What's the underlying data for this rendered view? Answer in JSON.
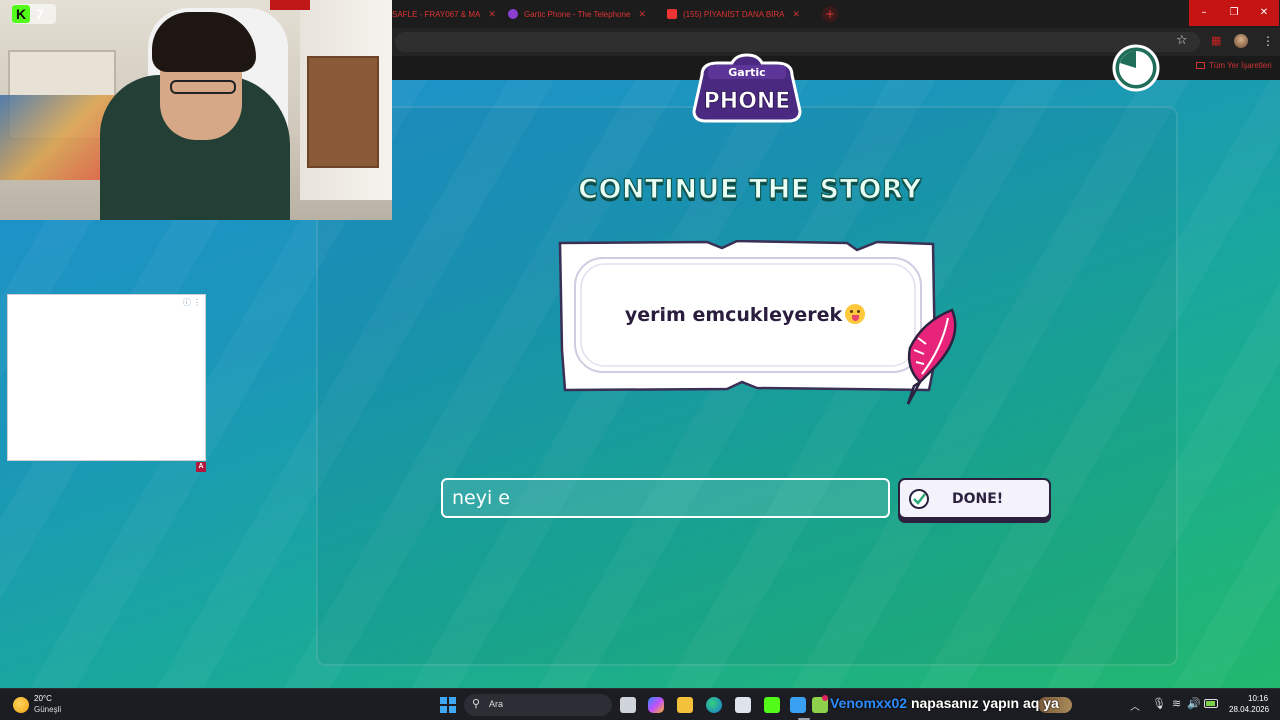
{
  "browser": {
    "tabs": [
      {
        "label": "SAFLE - FRAY067 & MA"
      },
      {
        "label": "Gartic Phone - The Telephone"
      },
      {
        "label": "(155) PİYANİST DANA BİRA"
      }
    ],
    "new_tab_icon": "plus-icon",
    "bookmarks_all_label": "Tüm Yer İşaretleri"
  },
  "stream_overlay": {
    "badge_letter": "K",
    "badge_count": "7"
  },
  "game": {
    "logo_top": "Gartic",
    "logo_bottom": "PHONE",
    "heading": "CONTINUE THE STORY",
    "prompt": "yerim emcukleyerek",
    "input_value": "neyi e",
    "done_label": "DONE!",
    "colors": {
      "accent": "#2b2240",
      "quill": "#e8237a",
      "heading_fill": "#e9fff6",
      "bg_top": "#1f8fd0",
      "bg_bottom": "#22b86e"
    }
  },
  "ad": {
    "badge": "A"
  },
  "taskbar": {
    "weather_temp": "20°C",
    "weather_desc": "Güneşli",
    "search_label": "Ara",
    "chat_user": "Venomxx02",
    "chat_message": "napasanız yapın aq ya",
    "time": "10:16",
    "date": "28.04.2026"
  }
}
